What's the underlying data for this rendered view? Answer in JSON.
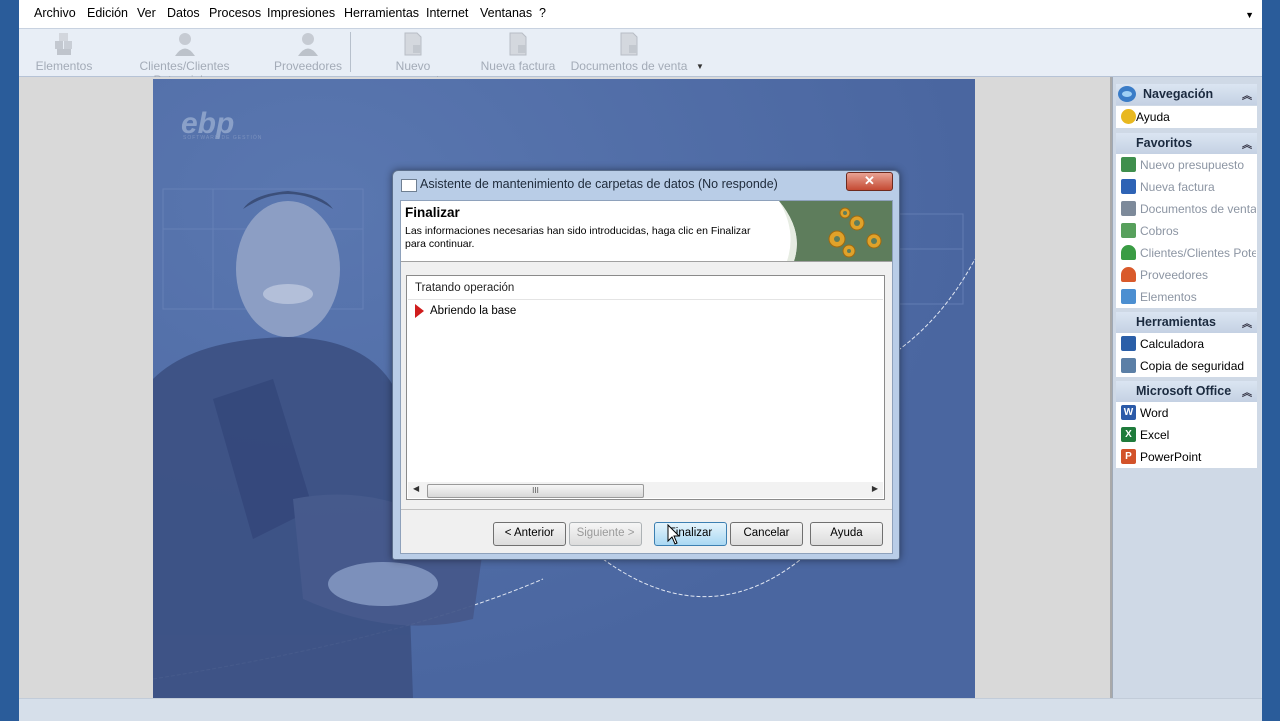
{
  "menu": {
    "items": [
      "Archivo",
      "Edición",
      "Ver",
      "Datos",
      "Procesos",
      "Impresiones",
      "Herramientas",
      "Internet",
      "Ventanas",
      "?"
    ],
    "overflow_icon": "chevron-down-icon"
  },
  "toolbar": {
    "buttons": [
      {
        "label": "Elementos",
        "icon": "elements-icon"
      },
      {
        "label": "Clientes/Clientes Potenciales",
        "icon": "client-icon"
      },
      {
        "label": "Proveedores",
        "icon": "supplier-icon"
      },
      {
        "label": "Nuevo presupuesto",
        "icon": "document-icon"
      },
      {
        "label": "Nueva factura",
        "icon": "document-icon"
      },
      {
        "label": "Documentos de venta",
        "icon": "document-icon"
      }
    ]
  },
  "splash": {
    "logo": "ebp",
    "tagline": "SOFTWARE DE GESTIÓN"
  },
  "nav": {
    "sections": [
      {
        "title": "Navegación",
        "icon": "globe-icon",
        "items": [
          {
            "label": "Ayuda",
            "icon": "help-icon",
            "color": "#e8b820"
          }
        ]
      },
      {
        "title": "Favoritos",
        "items": [
          {
            "label": "Nuevo presupuesto",
            "icon": "document-icon",
            "color": "#3f8f4d"
          },
          {
            "label": "Nueva factura",
            "icon": "document-icon",
            "color": "#2e63b5"
          },
          {
            "label": "Documentos de venta",
            "icon": "document-icon",
            "color": "#7d8a9a"
          },
          {
            "label": "Cobros",
            "icon": "payment-icon",
            "color": "#57a05c"
          },
          {
            "label": "Clientes/Clientes Pote...",
            "icon": "client-icon",
            "color": "#3a9c44"
          },
          {
            "label": "Proveedores",
            "icon": "supplier-icon",
            "color": "#d95a2b"
          },
          {
            "label": "Elementos",
            "icon": "elements-icon",
            "color": "#4c8fd1"
          }
        ]
      },
      {
        "title": "Herramientas",
        "items": [
          {
            "label": "Calculadora",
            "icon": "calculator-icon",
            "color": "#2b5fa8"
          },
          {
            "label": "Copia de seguridad",
            "icon": "backup-icon",
            "color": "#5b7fa6"
          }
        ]
      },
      {
        "title": "Microsoft Office",
        "items": [
          {
            "label": "Word",
            "icon": "word-icon",
            "color": "#2b5aa8"
          },
          {
            "label": "Excel",
            "icon": "excel-icon",
            "color": "#1f7b3c"
          },
          {
            "label": "PowerPoint",
            "icon": "powerpoint-icon",
            "color": "#d2522a"
          }
        ]
      }
    ]
  },
  "dialog": {
    "title": "Asistente de mantenimiento de carpetas de datos (No responde)",
    "close": "✕",
    "header_title": "Finalizar",
    "header_desc": "Las informaciones necesarias han sido introducidas, haga clic en Finalizar para continuar.",
    "op_header": "Tratando operación",
    "op_row": "Abriendo la base",
    "scroll_left": "◀",
    "scroll_right": "▶",
    "scroll_grip": "III",
    "buttons": {
      "back": "< Anterior",
      "next": "Siguiente >",
      "finish": "Finalizar",
      "cancel": "Cancelar",
      "help": "Ayuda"
    }
  }
}
